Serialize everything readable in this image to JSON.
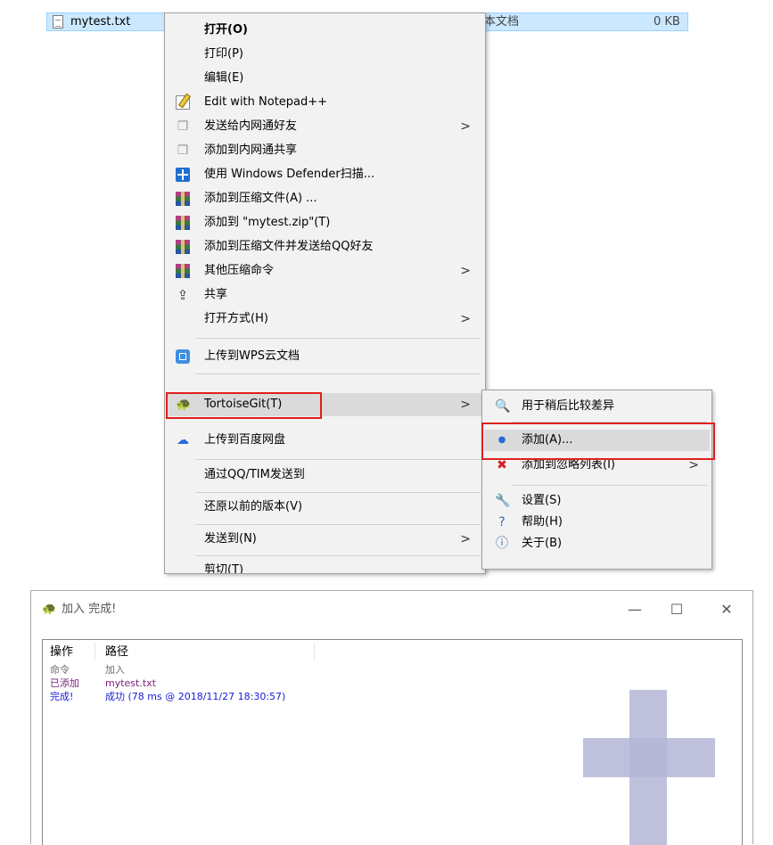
{
  "file_row": {
    "name": "mytest.txt",
    "type": "本文档",
    "size": "0 KB"
  },
  "context_menu": {
    "open": "打开(O)",
    "print": "打印(P)",
    "edit": "编辑(E)",
    "notepadpp": "Edit with Notepad++",
    "send_feiq": "发送给内网通好友",
    "add_feiq_share": "添加到内网通共享",
    "defender": "使用 Windows Defender扫描...",
    "add_archive": "添加到压缩文件(A) ...",
    "add_zip": "添加到 \"mytest.zip\"(T)",
    "add_zip_qq": "添加到压缩文件并发送给QQ好友",
    "other_compress": "其他压缩命令",
    "share": "共享",
    "open_with": "打开方式(H)",
    "wps_upload": "上传到WPS云文档",
    "tortoisegit": "TortoiseGit(T)",
    "baidu_upload": "上传到百度网盘",
    "send_qq_tim": "通过QQ/TIM发送到",
    "restore_prev": "还原以前的版本(V)",
    "send_to": "发送到(N)",
    "cut": "剪切(T)",
    "arrow": ">"
  },
  "submenu": {
    "diff_later": "用于稍后比较差异",
    "add": "添加(A)...",
    "add_ignore": "添加到忽略列表(I)",
    "settings": "设置(S)",
    "help": "帮助(H)",
    "about": "关于(B)",
    "arrow": ">"
  },
  "dialog": {
    "title": "加入 完成!",
    "minimize": "—",
    "maximize": "☐",
    "close": "✕",
    "columns": [
      "操作",
      "路径"
    ],
    "rows": [
      {
        "action": "命令",
        "path": "加入",
        "color": "#6d6d6d"
      },
      {
        "action": "已添加",
        "path": "mytest.txt",
        "color": "#7a1d7a"
      },
      {
        "action": "完成!",
        "path": "成功 (78 ms @ 2018/11/27 18:30:57)",
        "color": "#1a1adc"
      }
    ]
  },
  "colors": {
    "highlight_box": "#e0201e",
    "selection": "#cce8ff"
  }
}
